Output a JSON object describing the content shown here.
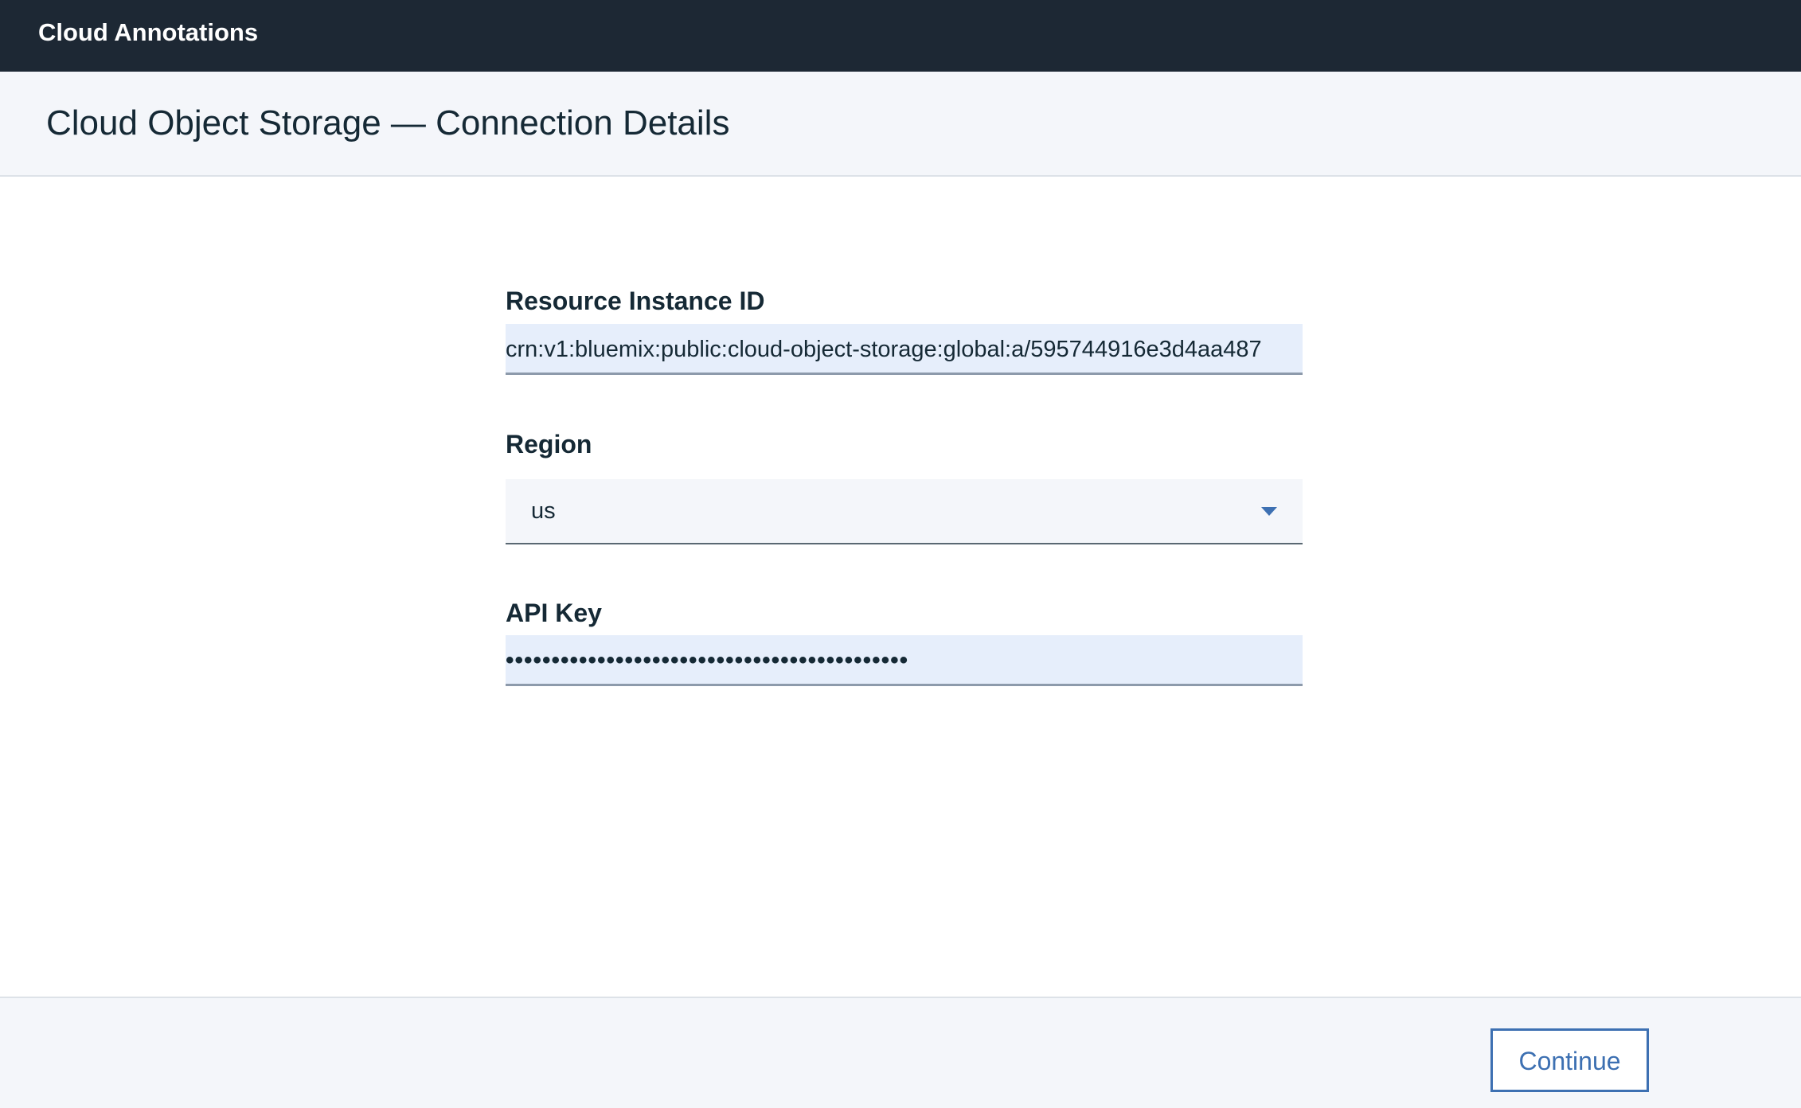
{
  "app": {
    "title": "Cloud Annotations"
  },
  "header": {
    "title": "Cloud Object Storage — Connection Details"
  },
  "form": {
    "resource_instance_id": {
      "label": "Resource Instance ID",
      "value": "crn:v1:bluemix:public:cloud-object-storage:global:a/595744916e3d4aa487"
    },
    "region": {
      "label": "Region",
      "selected": "us",
      "icon": "chevron-down-icon"
    },
    "api_key": {
      "label": "API Key",
      "masked_value": "••••••••••••••••••••••••••••••••••••••••••••"
    }
  },
  "footer": {
    "continue_label": "Continue"
  },
  "colors": {
    "topbar": "#1d2834",
    "header_bg": "#f4f6fa",
    "input_bg": "#e6eefb",
    "accent": "#3d70b2",
    "text": "#152935"
  }
}
